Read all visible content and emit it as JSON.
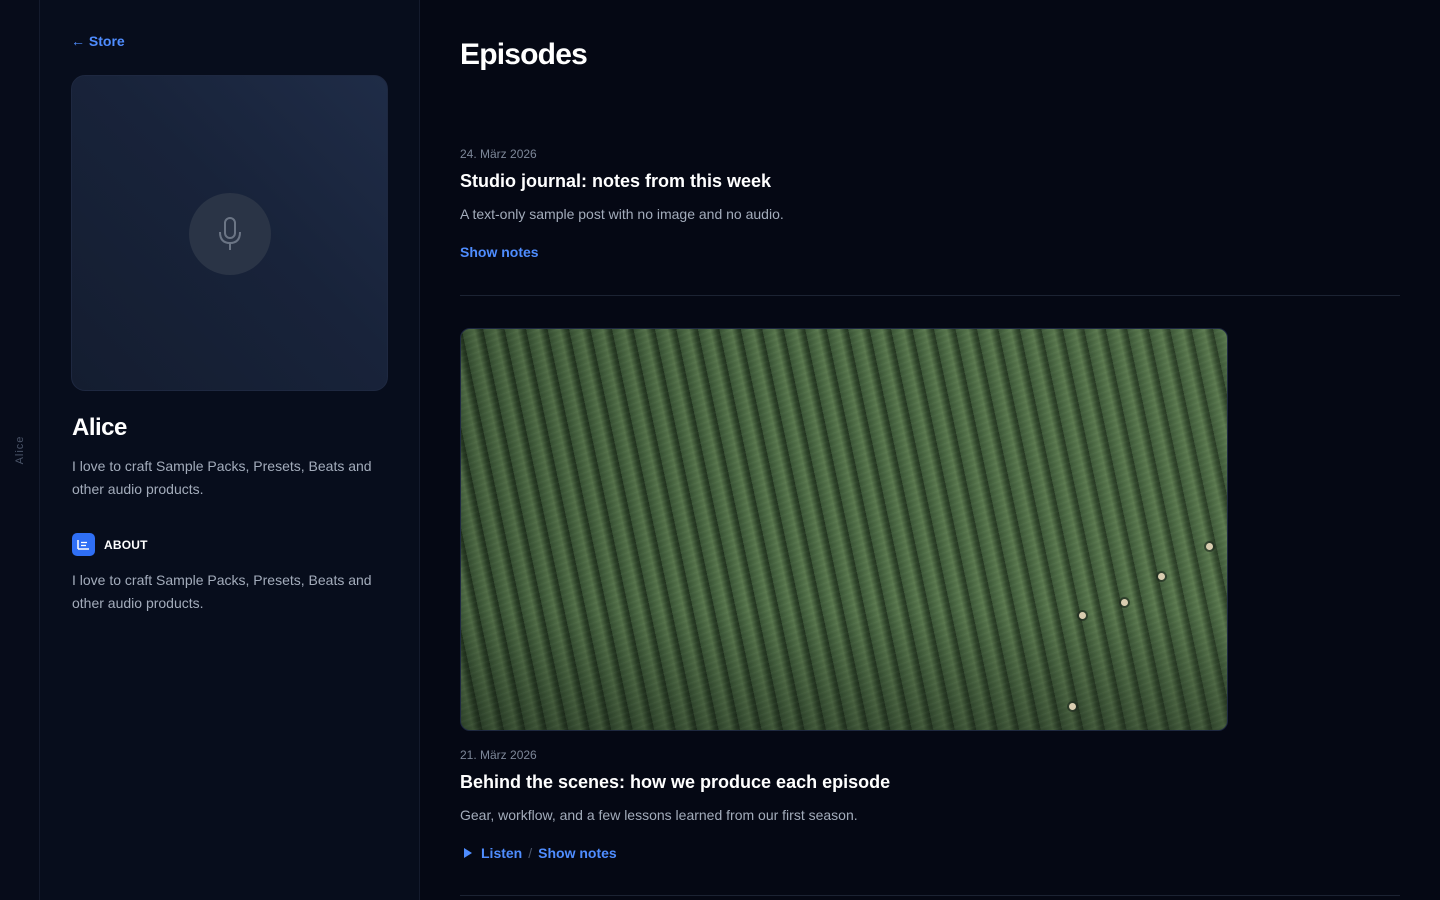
{
  "rail": {
    "label": "Alice"
  },
  "sidebar": {
    "back_label": "← Store",
    "cover_icon": "microphone-icon",
    "artist_name": "Alice",
    "artist_bio": "I love to craft Sample Packs, Presets, Beats and other audio products.",
    "about": {
      "icon": "document-lines-icon",
      "title": "ABOUT",
      "text": "I love to craft Sample Packs, Presets, Beats and other audio products."
    }
  },
  "main": {
    "title": "Episodes",
    "episodes": [
      {
        "date": "24. März 2026",
        "title": "Studio journal: notes from this week",
        "description": "A text-only sample post with no image and no audio.",
        "show_notes_label": "Show notes"
      },
      {
        "image": "aerial-tea-field-photo",
        "date": "21. März 2026",
        "title": "Behind the scenes: how we produce each episode",
        "description": "Gear, workflow, and a few lessons learned from our first season.",
        "listen_label": "Listen",
        "separator": "/",
        "show_notes_label": "Show notes"
      }
    ]
  },
  "colors": {
    "background": "#050814",
    "sidebar": "#070d1c",
    "accent": "#4f8dff",
    "about_icon_bg": "#2f6ff5"
  }
}
